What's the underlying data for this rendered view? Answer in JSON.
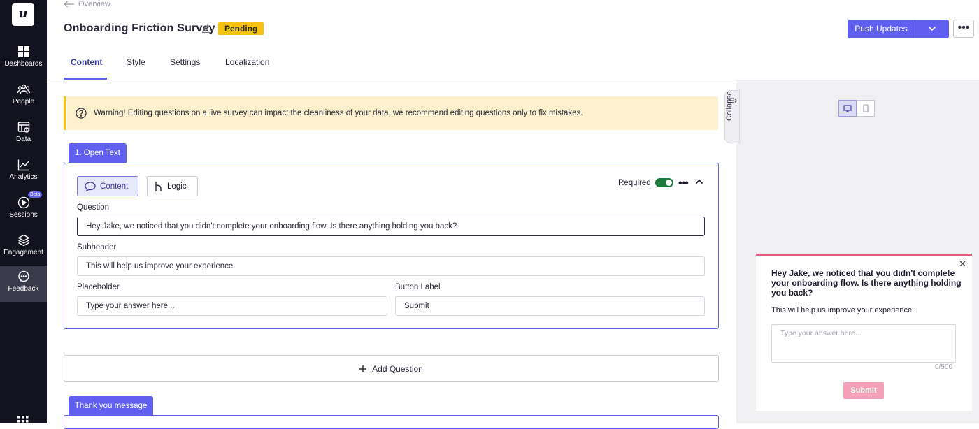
{
  "sidebar": {
    "logo": "u",
    "items": [
      {
        "label": "Dashboards",
        "icon": "dashboard-icon"
      },
      {
        "label": "People",
        "icon": "people-icon"
      },
      {
        "label": "Data",
        "icon": "data-icon"
      },
      {
        "label": "Analytics",
        "icon": "analytics-icon"
      },
      {
        "label": "Sessions",
        "icon": "sessions-icon",
        "badge": "Beta"
      },
      {
        "label": "Engagement",
        "icon": "engagement-icon"
      },
      {
        "label": "Feedback",
        "icon": "feedback-icon",
        "active": true
      }
    ]
  },
  "header": {
    "breadcrumb": "Overview",
    "title": "Onboarding Friction Survey",
    "status": "Pending",
    "push_label": "Push Updates",
    "tabs": [
      "Content",
      "Style",
      "Settings",
      "Localization"
    ],
    "active_tab": "Content"
  },
  "warning": "Warning! Editing questions on a live survey can impact the cleanliness of your data, we recommend editing questions only to fix mistakes.",
  "question": {
    "tab_label": "1. Open Text",
    "seg_content": "Content",
    "seg_logic": "Logic",
    "required_label": "Required",
    "required": true,
    "question_label": "Question",
    "question_value": "Hey Jake, we noticed that you didn't complete your onboarding flow. Is there anything holding you back?",
    "subheader_label": "Subheader",
    "subheader_value": "This will help us improve your experience.",
    "placeholder_label": "Placeholder",
    "placeholder_value": "Type your answer here...",
    "button_label_label": "Button Label",
    "button_label_value": "Submit"
  },
  "add_question": "Add Question",
  "thank_you_tab": "Thank you message",
  "preview": {
    "collapse_label": "Collapse",
    "question": "Hey Jake, we noticed that you didn't complete your onboarding flow. Is there anything holding you back?",
    "subheader": "This will help us improve your experience.",
    "placeholder": "Type your answer here...",
    "counter": "0/500",
    "submit": "Submit"
  },
  "colors": {
    "accent": "#5f5ff0",
    "badge": "#f5c211",
    "sidebar": "#13131f",
    "toggle_on": "#1c7a3a",
    "widget_accent": "#e85a80"
  }
}
